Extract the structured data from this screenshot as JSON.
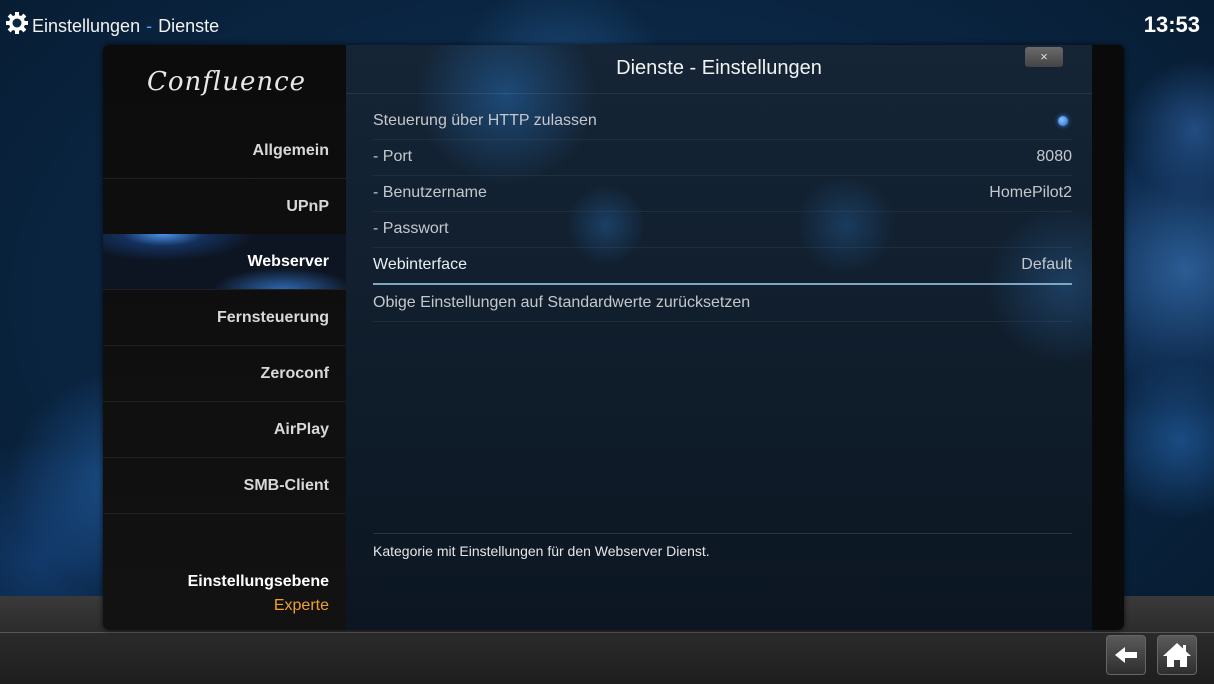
{
  "header": {
    "section": "Einstellungen",
    "separator": "-",
    "page": "Dienste",
    "clock": "13:53"
  },
  "sidebar": {
    "logo": "Confluence",
    "items": [
      {
        "label": "Allgemein"
      },
      {
        "label": "UPnP"
      },
      {
        "label": "Webserver",
        "active": true
      },
      {
        "label": "Fernsteuerung"
      },
      {
        "label": "Zeroconf"
      },
      {
        "label": "AirPlay"
      },
      {
        "label": "SMB-Client"
      }
    ],
    "level_label": "Einstellungsebene",
    "level_value": "Experte"
  },
  "dialog": {
    "title": "Dienste - Einstellungen",
    "close_label": "×",
    "settings": [
      {
        "label": "Steuerung über HTTP zulassen",
        "value": "",
        "toggle": "on"
      },
      {
        "label": "- Port",
        "value": "8080"
      },
      {
        "label": "- Benutzername",
        "value": "HomePilot2"
      },
      {
        "label": "- Passwort",
        "value": ""
      },
      {
        "label": "Webinterface",
        "value": "Default",
        "focused": true
      },
      {
        "label": "Obige Einstellungen auf Standardwerte zurücksetzen",
        "value": ""
      }
    ],
    "description": "Kategorie mit Einstellungen für den Webserver Dienst."
  },
  "footer": {
    "back_icon": "back-arrow-icon",
    "home_icon": "home-icon"
  },
  "colors": {
    "accent_blue": "#4aa3ff",
    "level_orange": "#f0a030"
  }
}
